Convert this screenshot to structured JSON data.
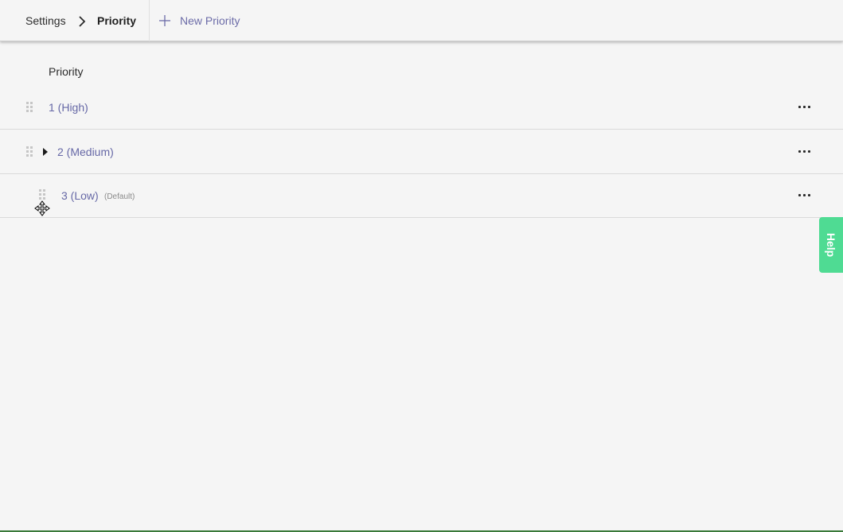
{
  "header": {
    "breadcrumb_parent": "Settings",
    "breadcrumb_current": "Priority",
    "new_button_label": "New Priority"
  },
  "list": {
    "column_header": "Priority",
    "rows": [
      {
        "label": "1 (High)",
        "badge": "",
        "has_children": false
      },
      {
        "label": "2 (Medium)",
        "badge": "",
        "has_children": true
      },
      {
        "label": "3 (Low)",
        "badge": "(Default)",
        "has_children": false
      }
    ]
  },
  "help": {
    "label": "Help"
  },
  "colors": {
    "accent": "#6668a6",
    "help_green": "#4fdb93",
    "background": "#f5f5f5"
  },
  "icons": {
    "breadcrumb_separator": "chevron-right-icon",
    "new_button": "plus-icon",
    "drag_handle": "drag-handle-icon",
    "expand": "caret-right-icon",
    "row_menu": "more-horizontal-icon",
    "cursor": "move-cursor-icon"
  }
}
